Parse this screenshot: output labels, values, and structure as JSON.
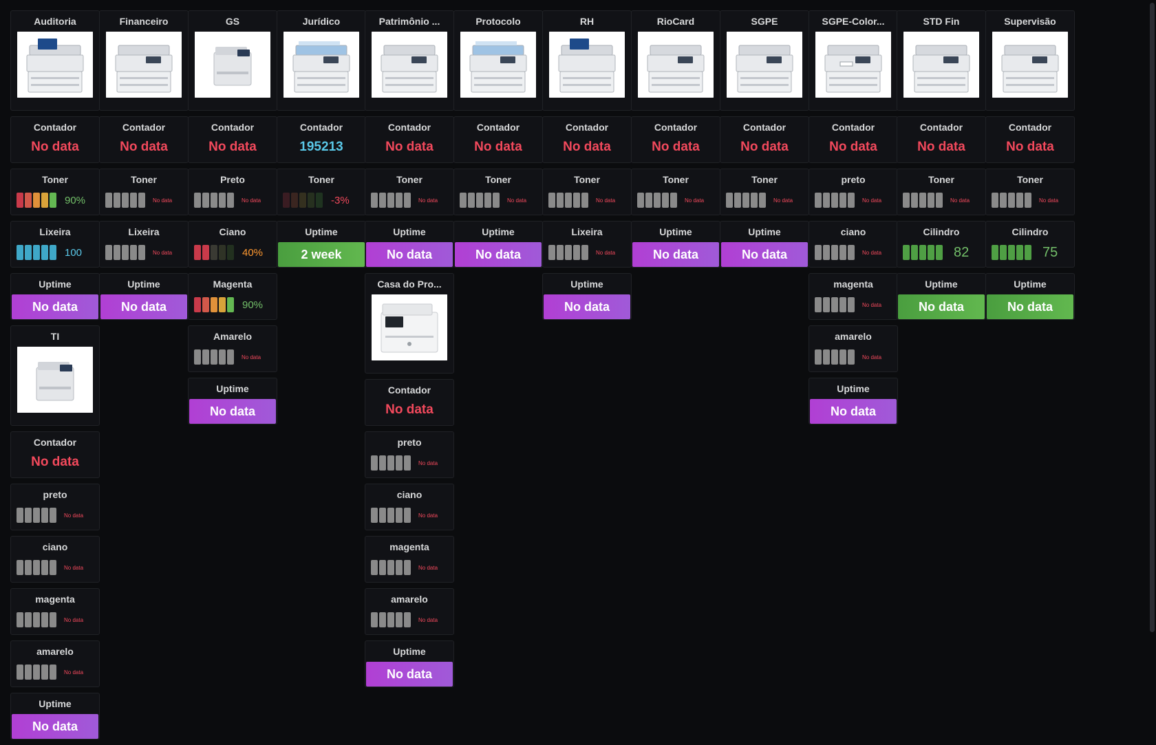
{
  "columns": [
    {
      "panels": [
        {
          "kind": "image",
          "title": "Auditoria",
          "image": "printer-mfp-touchscreen"
        },
        {
          "kind": "stat",
          "title": "Contador",
          "value": "No data",
          "status": "nodata"
        },
        {
          "kind": "gauge",
          "title": "Toner",
          "value": "90%",
          "level": 0.9,
          "cells": [
            "#c93a4a",
            "#d2584a",
            "#e0913a",
            "#d9a33a",
            "#64b852"
          ],
          "vstyle": "green"
        },
        {
          "kind": "gauge",
          "title": "Lixeira",
          "value": "100",
          "level": 1.0,
          "cells": [
            "#3fa8c8",
            "#3fa8c8",
            "#3fa8c8",
            "#3fa8c8",
            "#3fa8c8"
          ],
          "vstyle": "blue"
        },
        {
          "kind": "uptime",
          "title": "Uptime",
          "value": "No data",
          "color": "purple"
        },
        {
          "kind": "image",
          "title": "TI",
          "image": "printer-compact-mfp"
        },
        {
          "kind": "stat",
          "title": "Contador",
          "value": "No data",
          "status": "nodata"
        },
        {
          "kind": "gauge",
          "title": "preto",
          "value": "No data",
          "level": 0,
          "vstyle": "small"
        },
        {
          "kind": "gauge",
          "title": "ciano",
          "value": "No data",
          "level": 0,
          "vstyle": "small"
        },
        {
          "kind": "gauge",
          "title": "magenta",
          "value": "No data",
          "level": 0,
          "vstyle": "small"
        },
        {
          "kind": "gauge",
          "title": "amarelo",
          "value": "No data",
          "level": 0,
          "vstyle": "small"
        },
        {
          "kind": "uptime",
          "title": "Uptime",
          "value": "No data",
          "color": "purple"
        }
      ]
    },
    {
      "panels": [
        {
          "kind": "image",
          "title": "Financeiro",
          "image": "printer-mfp"
        },
        {
          "kind": "stat",
          "title": "Contador",
          "value": "No data",
          "status": "nodata"
        },
        {
          "kind": "gauge",
          "title": "Toner",
          "value": "No data",
          "level": 0,
          "vstyle": "small"
        },
        {
          "kind": "gauge",
          "title": "Lixeira",
          "value": "No data",
          "level": 0,
          "vstyle": "small"
        },
        {
          "kind": "uptime",
          "title": "Uptime",
          "value": "No data",
          "color": "purple"
        }
      ]
    },
    {
      "panels": [
        {
          "kind": "image",
          "title": "GS",
          "image": "printer-compact"
        },
        {
          "kind": "stat",
          "title": "Contador",
          "value": "No data",
          "status": "nodata"
        },
        {
          "kind": "gauge",
          "title": "Preto",
          "value": "No data",
          "level": 0,
          "vstyle": "small"
        },
        {
          "kind": "gauge",
          "title": "Ciano",
          "value": "40%",
          "level": 0.4,
          "cells": [
            "#c93a4a",
            "#c93a4a",
            "#3a3a33",
            "#2f3326",
            "#22301f"
          ],
          "vstyle": "orange"
        },
        {
          "kind": "gauge",
          "title": "Magenta",
          "value": "90%",
          "level": 0.9,
          "cells": [
            "#c93a4a",
            "#d2584a",
            "#e0913a",
            "#d9a33a",
            "#64b852"
          ],
          "vstyle": "green"
        },
        {
          "kind": "gauge",
          "title": "Amarelo",
          "value": "No data",
          "level": 0,
          "vstyle": "small"
        },
        {
          "kind": "uptime",
          "title": "Uptime",
          "value": "No data",
          "color": "purple"
        }
      ]
    },
    {
      "panels": [
        {
          "kind": "image",
          "title": "Jurídico",
          "image": "printer-blue-mfp"
        },
        {
          "kind": "stat",
          "title": "Contador",
          "value": "195213",
          "status": "blue"
        },
        {
          "kind": "gauge",
          "title": "Toner",
          "value": "-3%",
          "level": -0.03,
          "cells": [
            "#3a1c22",
            "#3a2520",
            "#34301f",
            "#26301f",
            "#1f3320"
          ],
          "vstyle": "red"
        },
        {
          "kind": "uptime",
          "title": "Uptime",
          "value": "2 week",
          "color": "green"
        }
      ]
    },
    {
      "panels": [
        {
          "kind": "image",
          "title": "Patrimônio ...",
          "image": "printer-mfp"
        },
        {
          "kind": "stat",
          "title": "Contador",
          "value": "No data",
          "status": "nodata"
        },
        {
          "kind": "gauge",
          "title": "Toner",
          "value": "No data",
          "level": 0,
          "vstyle": "small"
        },
        {
          "kind": "uptime",
          "title": "Uptime",
          "value": "No data",
          "color": "purple"
        },
        {
          "kind": "image",
          "title": "Casa do Pro...",
          "image": "printer-white-laser"
        },
        {
          "kind": "stat",
          "title": "Contador",
          "value": "No data",
          "status": "nodata"
        },
        {
          "kind": "gauge",
          "title": "preto",
          "value": "No data",
          "level": 0,
          "vstyle": "small"
        },
        {
          "kind": "gauge",
          "title": "ciano",
          "value": "No data",
          "level": 0,
          "vstyle": "small"
        },
        {
          "kind": "gauge",
          "title": "magenta",
          "value": "No data",
          "level": 0,
          "vstyle": "small"
        },
        {
          "kind": "gauge",
          "title": "amarelo",
          "value": "No data",
          "level": 0,
          "vstyle": "small"
        },
        {
          "kind": "uptime",
          "title": "Uptime",
          "value": "No data",
          "color": "purple"
        }
      ]
    },
    {
      "panels": [
        {
          "kind": "image",
          "title": "Protocolo",
          "image": "printer-blue-mfp"
        },
        {
          "kind": "stat",
          "title": "Contador",
          "value": "No data",
          "status": "nodata"
        },
        {
          "kind": "gauge",
          "title": "Toner",
          "value": "No data",
          "level": 0,
          "vstyle": "small"
        },
        {
          "kind": "uptime",
          "title": "Uptime",
          "value": "No data",
          "color": "purple"
        }
      ]
    },
    {
      "panels": [
        {
          "kind": "image",
          "title": "RH",
          "image": "printer-mfp-touchscreen"
        },
        {
          "kind": "stat",
          "title": "Contador",
          "value": "No data",
          "status": "nodata"
        },
        {
          "kind": "gauge",
          "title": "Toner",
          "value": "No data",
          "level": 0,
          "vstyle": "small"
        },
        {
          "kind": "gauge",
          "title": "Lixeira",
          "value": "No data",
          "level": 0,
          "vstyle": "small"
        },
        {
          "kind": "uptime",
          "title": "Uptime",
          "value": "No data",
          "color": "purple"
        }
      ]
    },
    {
      "panels": [
        {
          "kind": "image",
          "title": "RioCard",
          "image": "printer-mfp"
        },
        {
          "kind": "stat",
          "title": "Contador",
          "value": "No data",
          "status": "nodata"
        },
        {
          "kind": "gauge",
          "title": "Toner",
          "value": "No data",
          "level": 0,
          "vstyle": "small"
        },
        {
          "kind": "uptime",
          "title": "Uptime",
          "value": "No data",
          "color": "purple"
        }
      ]
    },
    {
      "panels": [
        {
          "kind": "image",
          "title": "SGPE",
          "image": "printer-mfp"
        },
        {
          "kind": "stat",
          "title": "Contador",
          "value": "No data",
          "status": "nodata"
        },
        {
          "kind": "gauge",
          "title": "Toner",
          "value": "No data",
          "level": 0,
          "vstyle": "small"
        },
        {
          "kind": "uptime",
          "title": "Uptime",
          "value": "No data",
          "color": "purple"
        }
      ]
    },
    {
      "panels": [
        {
          "kind": "image",
          "title": "SGPE-Color...",
          "image": "printer-color-mfp"
        },
        {
          "kind": "stat",
          "title": "Contador",
          "value": "No data",
          "status": "nodata"
        },
        {
          "kind": "gauge",
          "title": "preto",
          "value": "No data",
          "level": 0,
          "vstyle": "small"
        },
        {
          "kind": "gauge",
          "title": "ciano",
          "value": "No data",
          "level": 0,
          "vstyle": "small"
        },
        {
          "kind": "gauge",
          "title": "magenta",
          "value": "No data",
          "level": 0,
          "vstyle": "small"
        },
        {
          "kind": "gauge",
          "title": "amarelo",
          "value": "No data",
          "level": 0,
          "vstyle": "small"
        },
        {
          "kind": "uptime",
          "title": "Uptime",
          "value": "No data",
          "color": "purple"
        }
      ]
    },
    {
      "panels": [
        {
          "kind": "image",
          "title": "STD Fin",
          "image": "printer-grey-mfp"
        },
        {
          "kind": "stat",
          "title": "Contador",
          "value": "No data",
          "status": "nodata"
        },
        {
          "kind": "gauge",
          "title": "Toner",
          "value": "No data",
          "level": 0,
          "vstyle": "small"
        },
        {
          "kind": "gauge",
          "title": "Cilindro",
          "value": "82",
          "level": 0.82,
          "cells": [
            "#4f9f44",
            "#4f9f44",
            "#4f9f44",
            "#4f9f44",
            "#4f9f44"
          ],
          "vstyle": "big-green"
        },
        {
          "kind": "uptime",
          "title": "Uptime",
          "value": "No data",
          "color": "green"
        }
      ]
    },
    {
      "panels": [
        {
          "kind": "image",
          "title": "Supervisão",
          "image": "printer-grey-mfp"
        },
        {
          "kind": "stat",
          "title": "Contador",
          "value": "No data",
          "status": "nodata"
        },
        {
          "kind": "gauge",
          "title": "Toner",
          "value": "No data",
          "level": 0,
          "vstyle": "small"
        },
        {
          "kind": "gauge",
          "title": "Cilindro",
          "value": "75",
          "level": 0.75,
          "cells": [
            "#4f9f44",
            "#4f9f44",
            "#4f9f44",
            "#4f9f44",
            "#4f9f44"
          ],
          "vstyle": "big-green"
        },
        {
          "kind": "uptime",
          "title": "Uptime",
          "value": "No data",
          "color": "green"
        }
      ]
    }
  ]
}
